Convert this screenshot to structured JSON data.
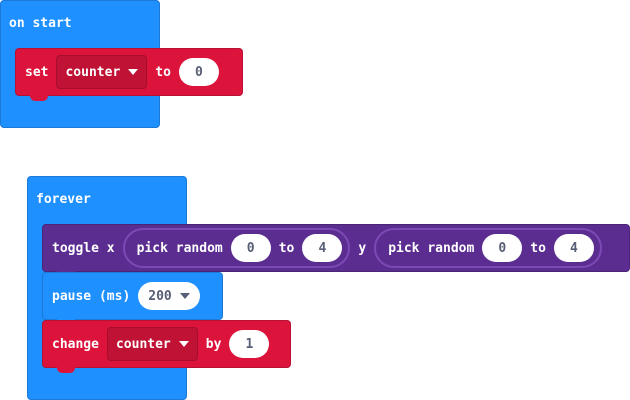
{
  "on_start": {
    "title": "on start",
    "set_block": {
      "keyword": "set",
      "variable": "counter",
      "to_label": "to",
      "value": "0"
    }
  },
  "forever": {
    "title": "forever",
    "toggle_block": {
      "keyword": "toggle x",
      "x_random": {
        "label": "pick random",
        "from": "0",
        "to_label": "to",
        "to": "4"
      },
      "y_label": "y",
      "y_random": {
        "label": "pick random",
        "from": "0",
        "to_label": "to",
        "to": "4"
      }
    },
    "pause_block": {
      "keyword": "pause (ms)",
      "value": "200"
    },
    "change_block": {
      "keyword": "change",
      "variable": "counter",
      "by_label": "by",
      "value": "1"
    }
  },
  "colors": {
    "basic": "#1e90ff",
    "variables": "#dc143c",
    "led": "#5c2d91",
    "field_text": "#575e75"
  }
}
